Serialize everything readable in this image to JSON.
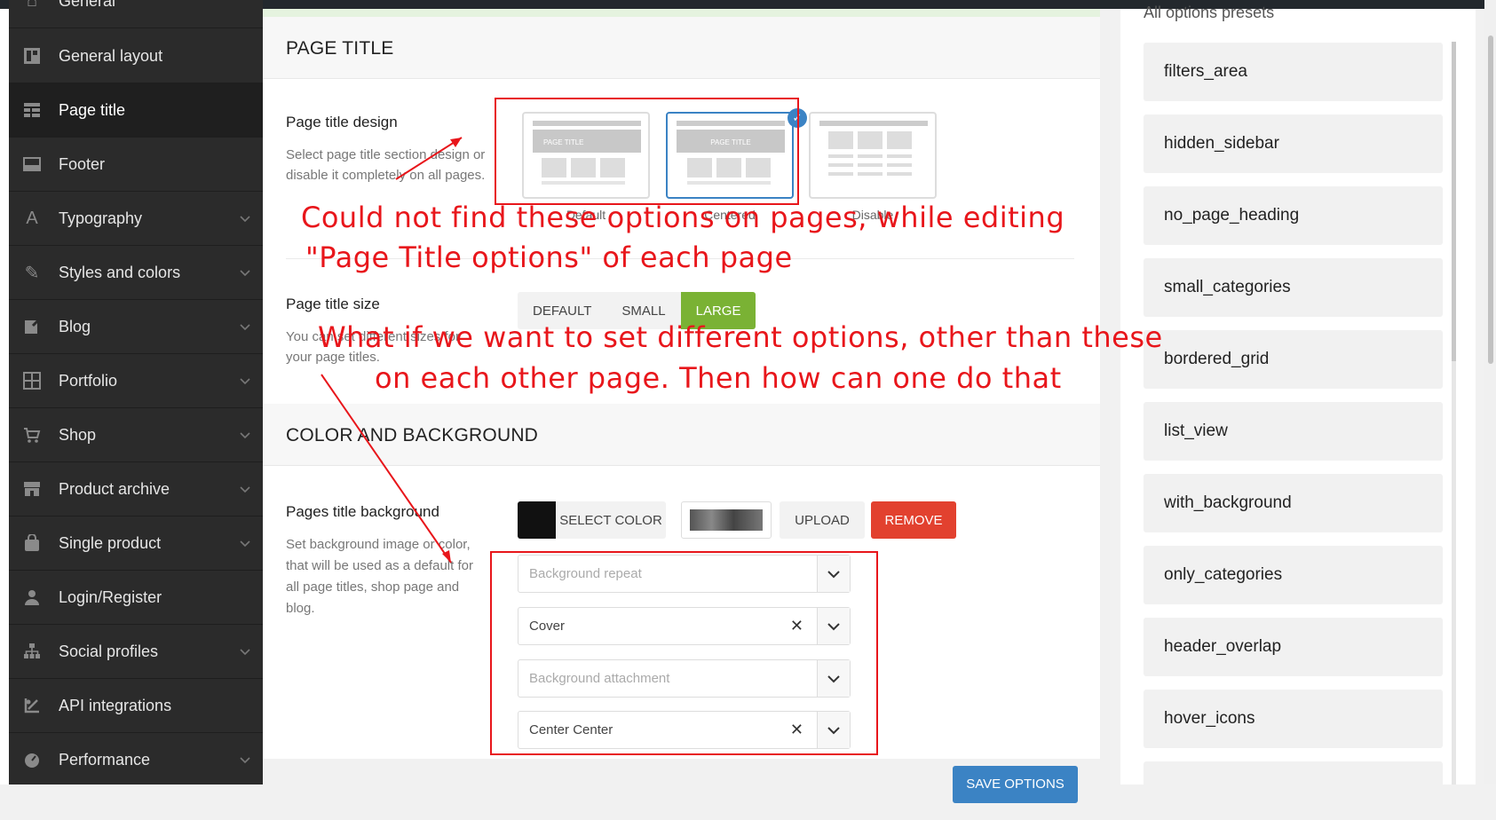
{
  "sidebar": {
    "items": [
      {
        "label": "General",
        "icon": "home-icon",
        "expandable": false
      },
      {
        "label": "General layout",
        "icon": "layout-icon",
        "expandable": false
      },
      {
        "label": "Page title",
        "icon": "page-title-icon",
        "expandable": false,
        "active": true
      },
      {
        "label": "Footer",
        "icon": "footer-icon",
        "expandable": false
      },
      {
        "label": "Typography",
        "icon": "typography-icon",
        "expandable": true
      },
      {
        "label": "Styles and colors",
        "icon": "brush-icon",
        "expandable": true
      },
      {
        "label": "Blog",
        "icon": "edit-icon",
        "expandable": true
      },
      {
        "label": "Portfolio",
        "icon": "grid-icon",
        "expandable": true
      },
      {
        "label": "Shop",
        "icon": "cart-icon",
        "expandable": true
      },
      {
        "label": "Product archive",
        "icon": "store-icon",
        "expandable": true
      },
      {
        "label": "Single product",
        "icon": "bag-icon",
        "expandable": true
      },
      {
        "label": "Login/Register",
        "icon": "user-icon",
        "expandable": false
      },
      {
        "label": "Social profiles",
        "icon": "network-icon",
        "expandable": true
      },
      {
        "label": "API integrations",
        "icon": "api-icon",
        "expandable": false
      },
      {
        "label": "Performance",
        "icon": "gauge-icon",
        "expandable": true
      }
    ]
  },
  "main": {
    "page_title_section": "PAGE TITLE",
    "design_option": {
      "title": "Page title design",
      "desc_1": "Select page title section design or",
      "desc_2": "disable it completely on all pages.",
      "cards": [
        {
          "caption": "Default",
          "mini_label": "PAGE TITLE"
        },
        {
          "caption": "Centered",
          "mini_label": "PAGE TITLE",
          "selected": true
        },
        {
          "caption": "Disable",
          "mini_label": ""
        }
      ]
    },
    "size_option": {
      "title": "Page title size",
      "desc_1": "You can set different sizes for",
      "desc_2": "your page titles.",
      "buttons": [
        "DEFAULT",
        "SMALL",
        "LARGE"
      ],
      "selected": "LARGE"
    },
    "color_section": "COLOR AND BACKGROUND",
    "background_option": {
      "title": "Pages title background",
      "desc_1": "Set background image or color,",
      "desc_2": "that will be used as a default for",
      "desc_3": "all page titles, shop page and",
      "desc_4": "blog.",
      "select_color": "SELECT COLOR",
      "upload": "UPLOAD",
      "remove": "REMOVE",
      "selects": [
        {
          "value": "Background repeat",
          "placeholder": true,
          "clearable": false
        },
        {
          "value": "Cover",
          "placeholder": false,
          "clearable": true
        },
        {
          "value": "Background attachment",
          "placeholder": true,
          "clearable": false
        },
        {
          "value": "Center Center",
          "placeholder": false,
          "clearable": true
        }
      ]
    },
    "save_button": "SAVE OPTIONS"
  },
  "presets": {
    "title": "All options presets",
    "items": [
      "filters_area",
      "hidden_sidebar",
      "no_page_heading",
      "small_categories",
      "bordered_grid",
      "list_view",
      "with_background",
      "only_categories",
      "header_overlap",
      "hover_icons"
    ]
  },
  "annotations": {
    "note_1_line_1": "Could not find these options on pages, while editing",
    "note_1_line_2": "\"Page Title options\" of each page",
    "note_2_line_1": "What if we want to set different options, other than these",
    "note_2_line_2": "on each other page. Then how can one do that",
    "color": "#e8161b"
  }
}
